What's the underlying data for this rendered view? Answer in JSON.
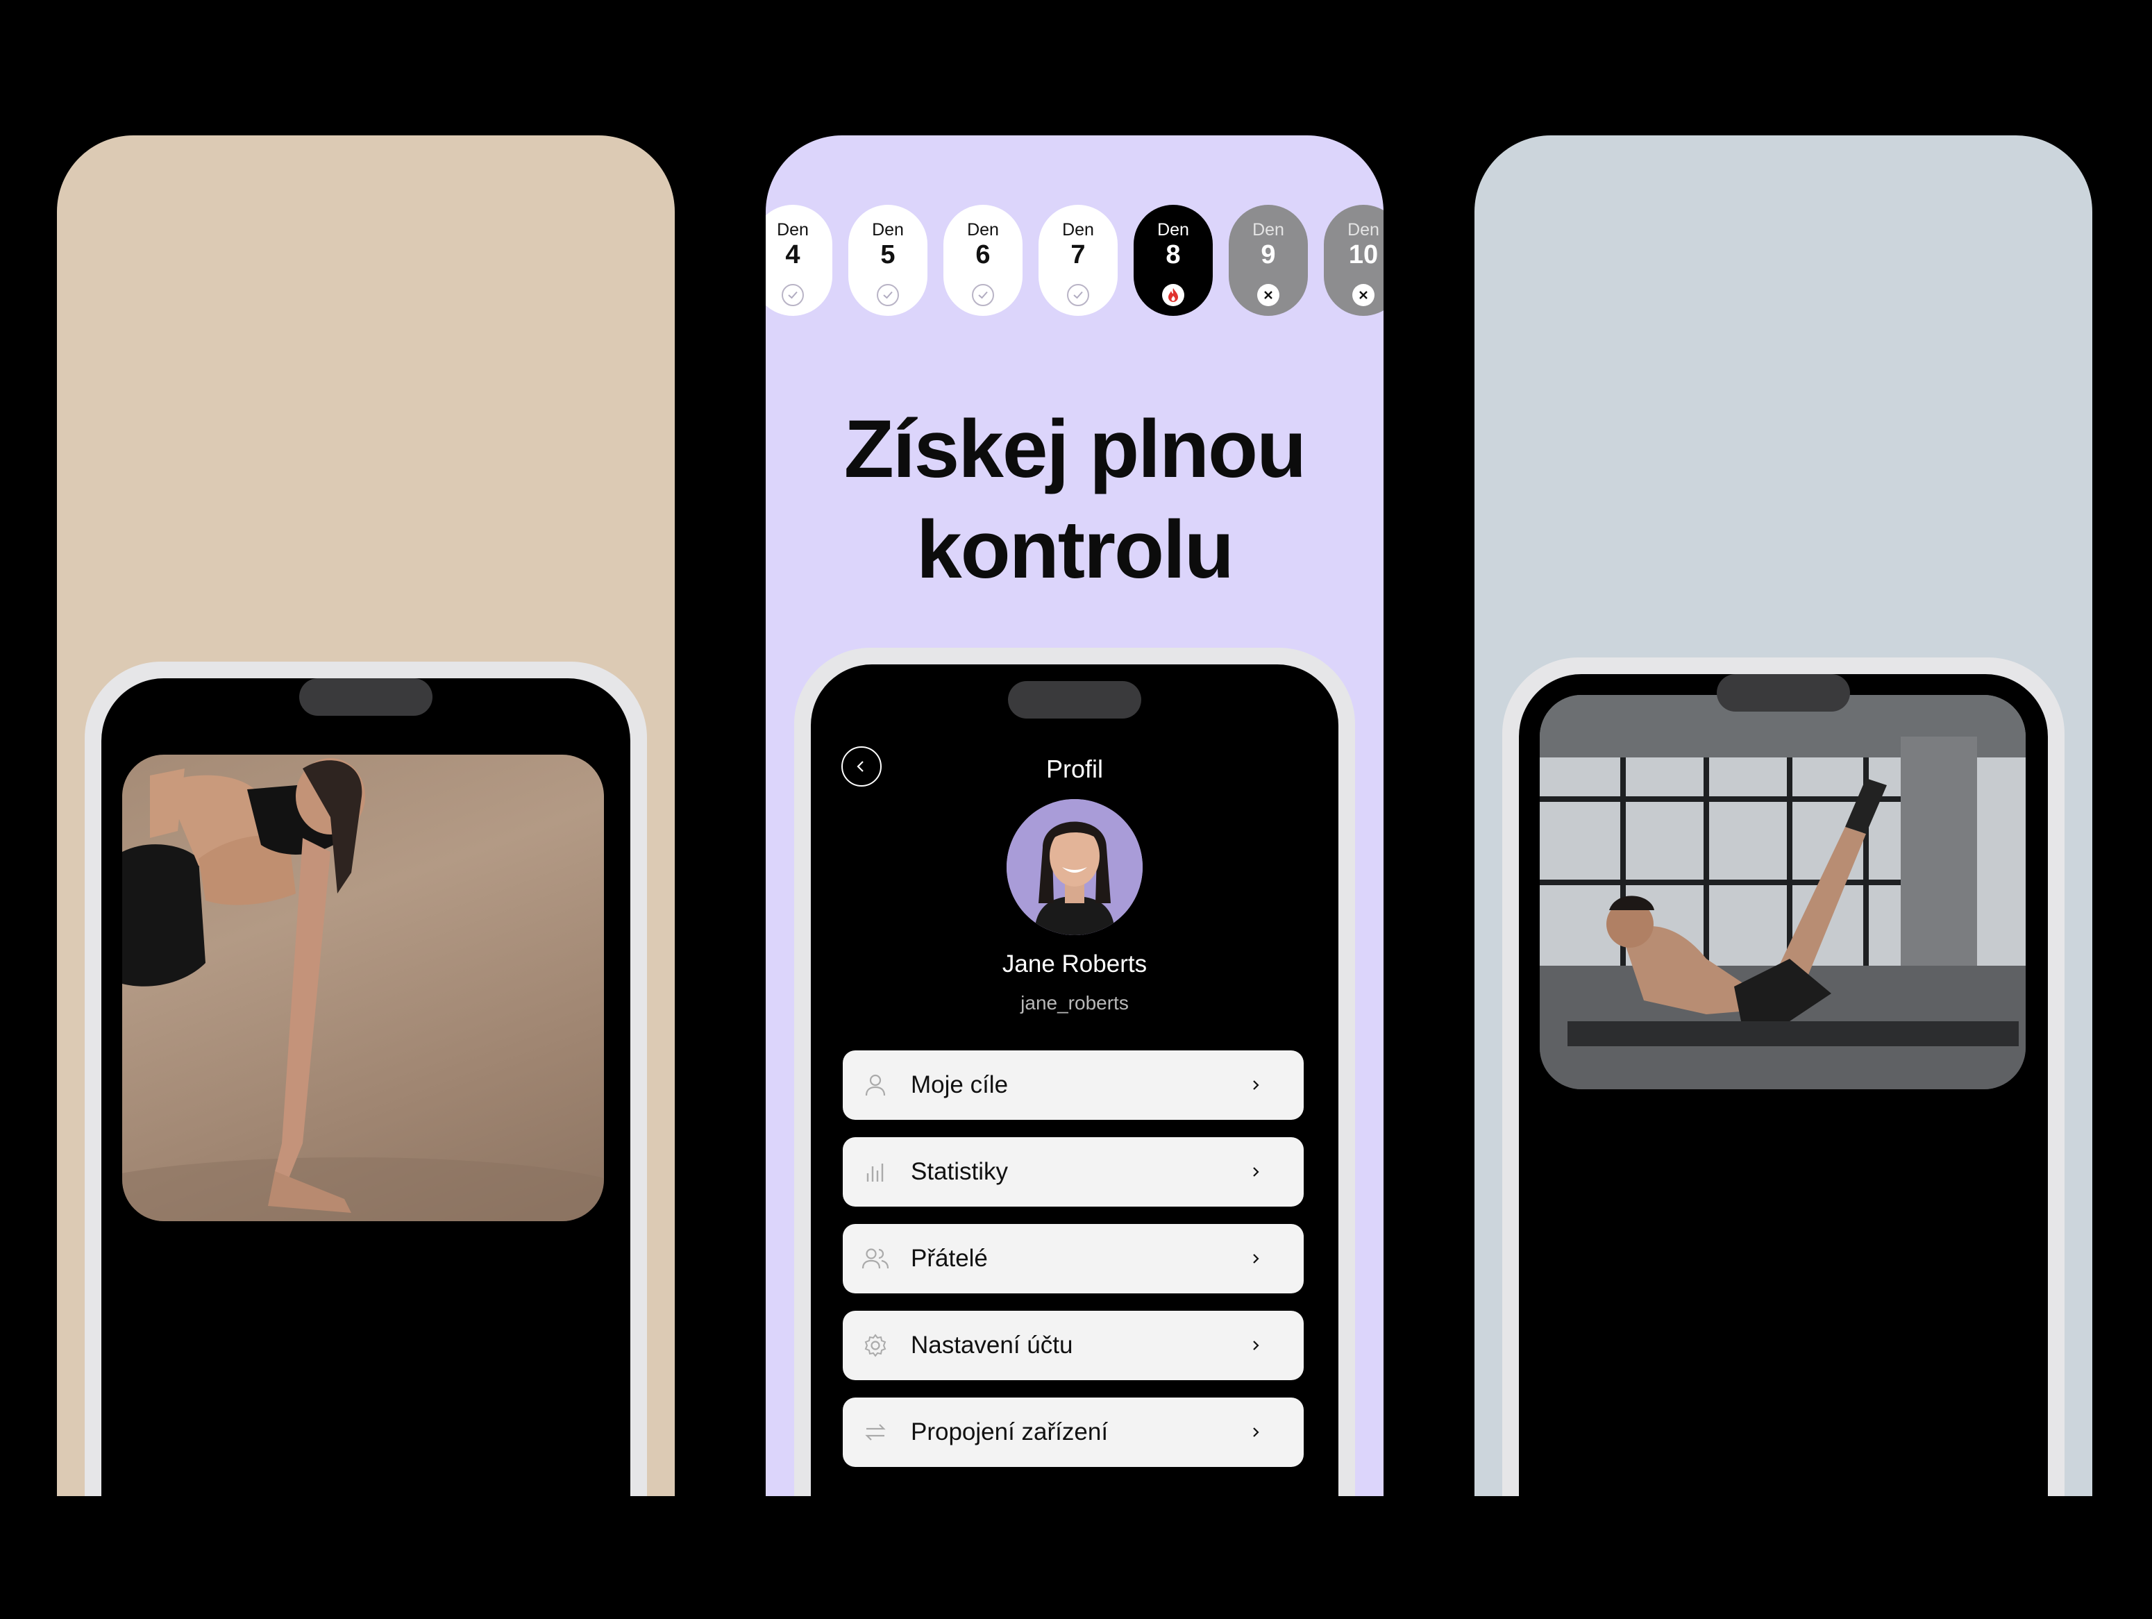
{
  "left_card": {
    "bg": "#dccab4",
    "photo_alt": "woman-side-plank-photo"
  },
  "center_card": {
    "bg": "#dcd5fb",
    "days": [
      {
        "label": "Den",
        "num": "4",
        "state": "done"
      },
      {
        "label": "Den",
        "num": "5",
        "state": "done"
      },
      {
        "label": "Den",
        "num": "6",
        "state": "done"
      },
      {
        "label": "Den",
        "num": "7",
        "state": "done"
      },
      {
        "label": "Den",
        "num": "8",
        "state": "active"
      },
      {
        "label": "Den",
        "num": "9",
        "state": "missed"
      },
      {
        "label": "Den",
        "num": "10",
        "state": "missed"
      }
    ],
    "headline_line1": "Získej plnou",
    "headline_line2": "kontrolu",
    "profile": {
      "title": "Profil",
      "name": "Jane Roberts",
      "handle": "jane_roberts",
      "menu": [
        {
          "label": "Moje cíle",
          "icon": "user-icon"
        },
        {
          "label": "Statistiky",
          "icon": "bar-chart-icon"
        },
        {
          "label": "Přátelé",
          "icon": "friends-icon"
        },
        {
          "label": "Nastavení účtu",
          "icon": "gear-icon"
        },
        {
          "label": "Propojení zařízení",
          "icon": "sync-icon"
        }
      ]
    }
  },
  "right_card": {
    "bg": "#ccd5dc",
    "photo_alt": "man-abs-workout-photo"
  }
}
